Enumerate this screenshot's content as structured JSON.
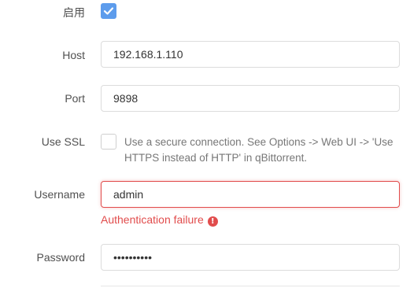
{
  "form": {
    "enable": {
      "label": "启用",
      "checked": true
    },
    "host": {
      "label": "Host",
      "value": "192.168.1.110"
    },
    "port": {
      "label": "Port",
      "value": "9898"
    },
    "use_ssl": {
      "label": "Use SSL",
      "checked": false,
      "help": "Use a secure connection. See Options -> Web UI -> 'Use HTTPS instead of HTTP' in qBittorrent."
    },
    "username": {
      "label": "Username",
      "value": "admin",
      "error": "Authentication failure",
      "error_icon": "!"
    },
    "password": {
      "label": "Password",
      "value": "••••••••••"
    }
  },
  "colors": {
    "accent": "#5d9cec",
    "error": "#e14c4c",
    "label": "#505050",
    "border": "#dcdcdc"
  }
}
